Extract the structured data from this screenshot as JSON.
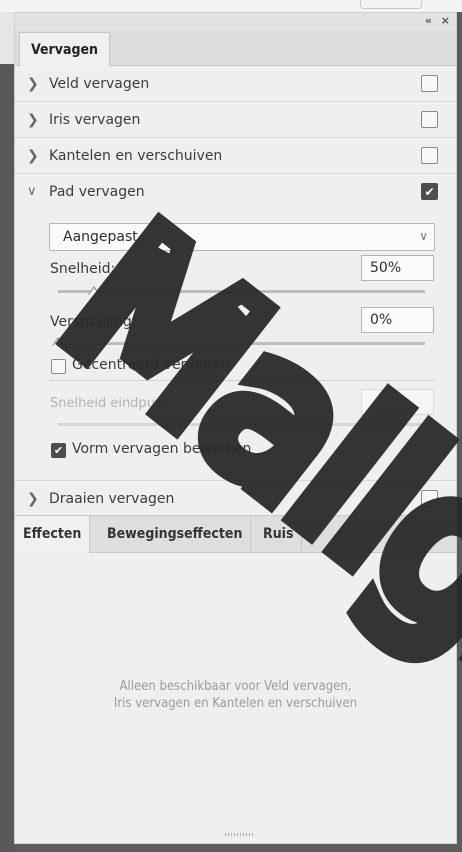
{
  "window": {
    "collapse_glyph": "«",
    "close_glyph": "×"
  },
  "panel": {
    "tab_label": "Vervagen"
  },
  "rows": [
    {
      "label": "Veld vervagen",
      "expanded": false,
      "checked": false
    },
    {
      "label": "Iris vervagen",
      "expanded": false,
      "checked": false
    },
    {
      "label": "Kantelen en verschuiven",
      "expanded": false,
      "checked": false
    },
    {
      "label": "Pad vervagen",
      "expanded": true,
      "checked": true
    }
  ],
  "path_blur": {
    "preset": "Aangepast",
    "speed_label": "Snelheid:",
    "speed_value": "50%",
    "taper_label": "Versmalling:",
    "taper_value": "0%",
    "centered_label": "Gecentreerd vervagen",
    "centered_checked": false,
    "end_speed_label": "Snelheid eindpunt:",
    "end_speed_value": "",
    "edit_shape_label": "Vorm vervagen bewerken",
    "edit_shape_checked": true
  },
  "spin_row": {
    "label": "Draaien vervagen",
    "checked": false
  },
  "effects": {
    "tabs": [
      "Effecten",
      "Bewegingseffecten",
      "Ruis"
    ],
    "active_tab": "Effecten",
    "message_line1": "Alleen beschikbaar voor Veld vervagen,",
    "message_line2": "Iris vervagen en Kantelen en verschuiven"
  },
  "watermark": {
    "text": "Maligro"
  },
  "icons": {
    "collapsed": "chevron-right-icon",
    "expanded": "chevron-down-icon",
    "check": "checkmark-icon"
  }
}
